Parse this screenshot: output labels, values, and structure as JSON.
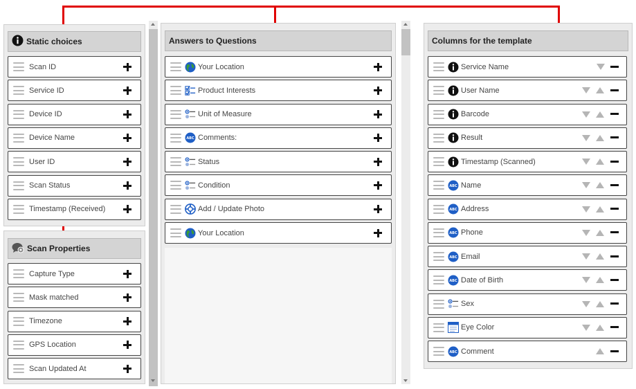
{
  "static_choices": {
    "title": "Static choices",
    "items": [
      {
        "label": "Scan ID"
      },
      {
        "label": "Service ID"
      },
      {
        "label": "Device ID"
      },
      {
        "label": "Device Name"
      },
      {
        "label": "User ID"
      },
      {
        "label": "Scan Status"
      },
      {
        "label": "Timestamp (Received)"
      }
    ]
  },
  "scan_properties": {
    "title": "Scan Properties",
    "items": [
      {
        "label": "Capture Type"
      },
      {
        "label": "Mask matched"
      },
      {
        "label": "Timezone"
      },
      {
        "label": "GPS Location"
      },
      {
        "label": "Scan Updated At"
      }
    ]
  },
  "answers": {
    "title": "Answers to Questions",
    "items": [
      {
        "label": "Your Location",
        "icon": "globe-icon"
      },
      {
        "label": "Product Interests",
        "icon": "checklist-icon"
      },
      {
        "label": "Unit of Measure",
        "icon": "radio-list-icon"
      },
      {
        "label": "Comments:",
        "icon": "text-abc-icon"
      },
      {
        "label": "Status",
        "icon": "radio-list-icon"
      },
      {
        "label": "Condition",
        "icon": "radio-list-icon"
      },
      {
        "label": "Add / Update Photo",
        "icon": "photo-lifebuoy-icon"
      },
      {
        "label": "Your Location",
        "icon": "globe-icon"
      }
    ]
  },
  "template_columns": {
    "title": "Columns for the template",
    "items": [
      {
        "label": "Service Name",
        "icon": "info-icon"
      },
      {
        "label": "User Name",
        "icon": "info-icon"
      },
      {
        "label": "Barcode",
        "icon": "info-icon"
      },
      {
        "label": "Result",
        "icon": "info-icon"
      },
      {
        "label": "Timestamp (Scanned)",
        "icon": "info-icon"
      },
      {
        "label": "Name",
        "icon": "text-abc-icon"
      },
      {
        "label": "Address",
        "icon": "text-abc-icon"
      },
      {
        "label": "Phone",
        "icon": "text-abc-icon"
      },
      {
        "label": "Email",
        "icon": "text-abc-icon"
      },
      {
        "label": "Date of Birth",
        "icon": "text-abc-icon"
      },
      {
        "label": "Sex",
        "icon": "radio-list-icon"
      },
      {
        "label": "Eye Color",
        "icon": "dropdown-list-icon"
      },
      {
        "label": "Comment",
        "icon": "text-abc-icon"
      }
    ]
  },
  "colors": {
    "flow_arrow": "#e00000",
    "panel_bg": "#ececec",
    "header_bg": "#d4d4d4",
    "item_border": "#444444",
    "icon_blue": "#1f5fc6"
  }
}
